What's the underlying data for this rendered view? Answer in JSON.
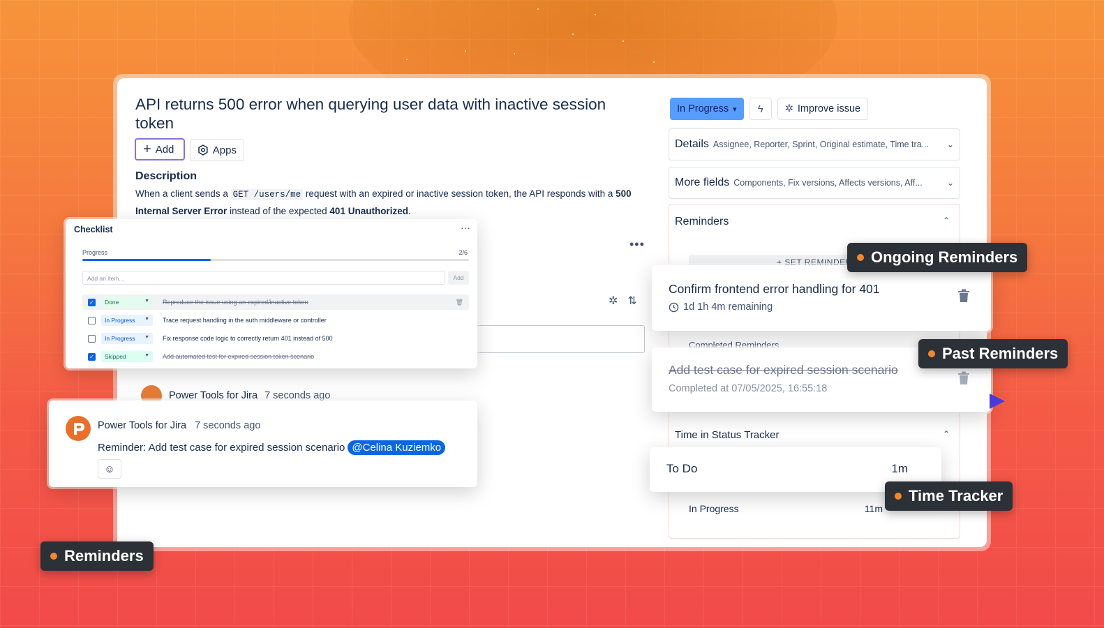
{
  "issue": {
    "title": "API returns 500 error when querying user data with inactive session token",
    "add_label": "Add",
    "apps_label": "Apps",
    "description_heading": "Description",
    "description_1": "When a client sends a ",
    "description_code": "GET /users/me",
    "description_2": " request with an expired or inactive session token, the API responds with a ",
    "description_bold_1": "500 Internal Server Error",
    "description_3": " instead of the expected ",
    "description_bold_2": "401 Unauthorized",
    "description_4": "."
  },
  "background_comment": {
    "author": "Power Tools for Jira",
    "time": "7 seconds ago"
  },
  "sidebar": {
    "status": "In Progress",
    "improve_label": "Improve issue",
    "details_title": "Details",
    "details_sub": "Assignee, Reporter, Sprint, Original estimate, Time tra...",
    "more_title": "More fields",
    "more_sub": "Components, Fix versions, Affects versions, Aff...",
    "reminders_title": "Reminders",
    "set_reminder": "+ SET REMINDER",
    "completed_label": "Completed Reminders",
    "tis_title": "Time in Status Tracker",
    "tis_rows": [
      {
        "status": "To Do",
        "time": "1m"
      },
      {
        "status": "In Progress",
        "time": "11m"
      }
    ]
  },
  "checklist": {
    "title": "Checklist",
    "progress_label": "Progress",
    "progress_value": "2/6",
    "progress_fraction": 0.333,
    "add_placeholder": "Add an item...",
    "add_button": "Add",
    "items": [
      {
        "status": "Done",
        "text": "Reproduce the issue using an expired/inactive token",
        "checked": true,
        "strike": true
      },
      {
        "status": "In Progress",
        "text": "Trace request handling in the auth middleware or controller",
        "checked": false,
        "strike": false
      },
      {
        "status": "In Progress",
        "text": "Fix response code logic to correctly return 401 instead of 500",
        "checked": false,
        "strike": false
      },
      {
        "status": "Skipped",
        "text": "Add automated test for expired session token scenario",
        "checked": true,
        "strike": true
      }
    ]
  },
  "comment": {
    "author": "Power Tools for Jira",
    "time": "7 seconds ago",
    "body": "Reminder: Add test case for expired session scenario",
    "mention": "@Celina Kuziemko"
  },
  "ongoing_reminder": {
    "title": "Confirm frontend error handling for 401",
    "remaining": "1d 1h 4m remaining"
  },
  "past_reminder": {
    "title": "Add test case for expired session scenario",
    "completed": "Completed at 07/05/2025, 16:55:18"
  },
  "tags": {
    "ongoing": "Ongoing Reminders",
    "past": "Past Reminders",
    "time_tracker": "Time Tracker",
    "reminders": "Reminders"
  },
  "colors": {
    "accent": "#0c66e4",
    "status_blue": "#579dff",
    "tag_dot": "#f5872b",
    "tag_bg": "#2c3138"
  }
}
